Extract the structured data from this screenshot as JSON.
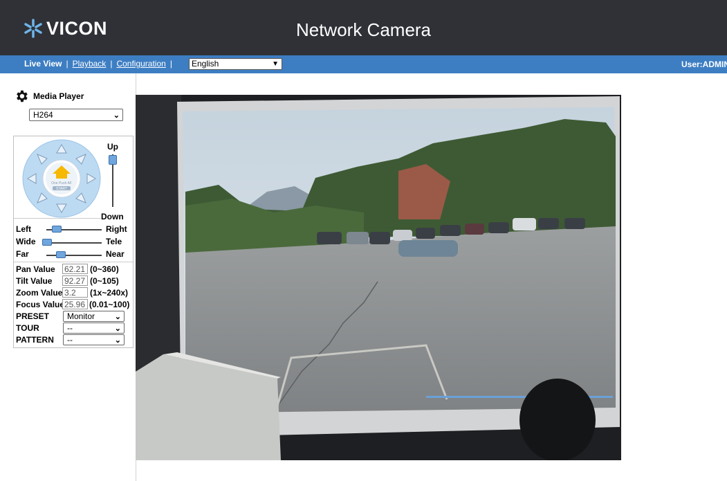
{
  "header": {
    "logo": "VICON",
    "title": "Network Camera"
  },
  "nav": {
    "live_view": "Live View",
    "separator": "|",
    "playback": "Playback",
    "configuration": "Configuration",
    "language": "English",
    "user": "User:ADMIN"
  },
  "sidebar": {
    "media_player_label": "Media Player",
    "codec": "H264",
    "ptz": {
      "home_label": "One Push AF",
      "start_label": "START",
      "up": "Up",
      "down": "Down",
      "left": "Left",
      "right": "Right",
      "wide": "Wide",
      "tele": "Tele",
      "far": "Far",
      "near": "Near",
      "pan_label": "Pan Value",
      "pan_value": "62.21",
      "pan_range": "(0~360)",
      "tilt_label": "Tilt Value",
      "tilt_value": "92.27",
      "tilt_range": "(0~105)",
      "zoom_label": "Zoom Value",
      "zoom_value": "3.2",
      "zoom_range": "(1x~240x)",
      "focus_label": "Focus Value",
      "focus_value": "25.96",
      "focus_range": "(0.01~100)",
      "preset_label": "PRESET",
      "preset_value": "Monitor",
      "tour_label": "TOUR",
      "tour_value": "--",
      "pattern_label": "PATTERN",
      "pattern_value": "--"
    }
  },
  "colors": {
    "header_bg": "#2f3137",
    "nav_bg": "#3d7ec3",
    "dial_blue": "#bcdaf2",
    "home_yellow": "#f6b800"
  },
  "icons": {
    "logo": "vicon-star-icon",
    "settings": "gear-icon",
    "home": "home-icon"
  }
}
